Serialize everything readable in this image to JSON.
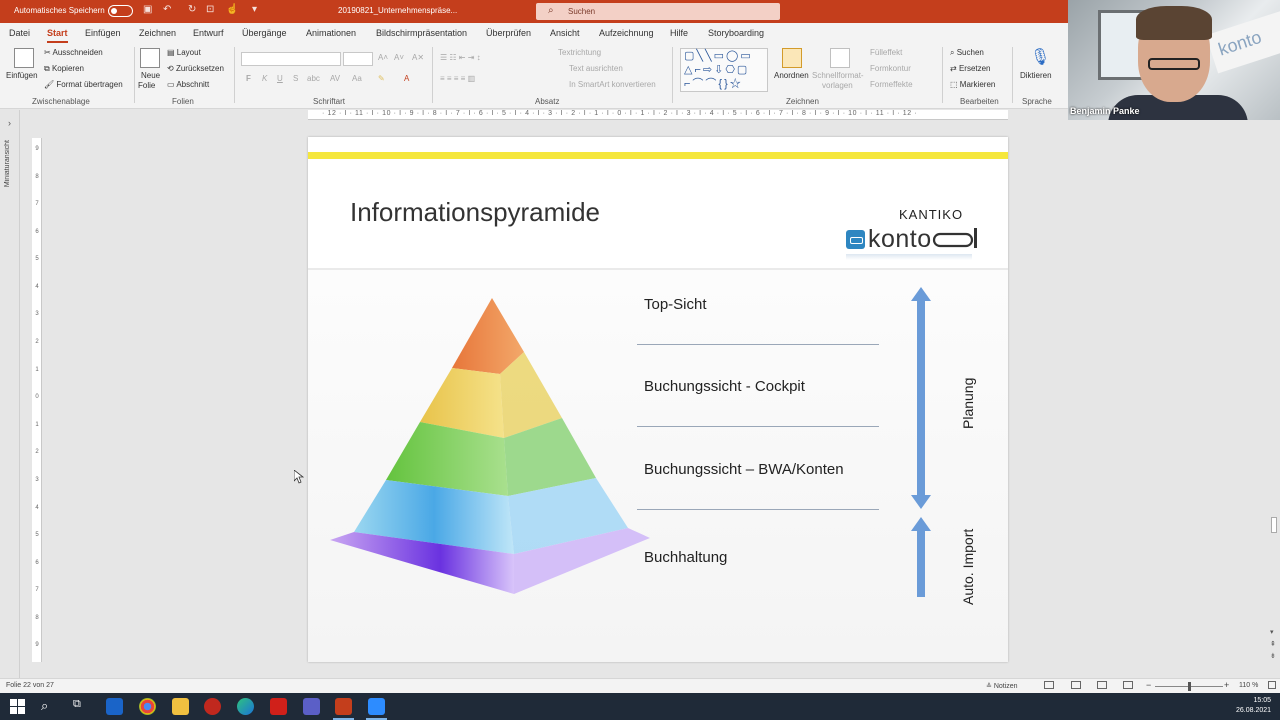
{
  "titlebar": {
    "autosave_label": "Automatisches Speichern",
    "filename": "20190821_Unternehmenspräse...",
    "search_placeholder": "Suchen"
  },
  "tabs": [
    "Datei",
    "Start",
    "Einfügen",
    "Zeichnen",
    "Entwurf",
    "Übergänge",
    "Animationen",
    "Bildschirmpräsentation",
    "Überprüfen",
    "Ansicht",
    "Aufzeichnung",
    "Hilfe",
    "Storyboarding"
  ],
  "active_tab": "Start",
  "ribbon": {
    "clipboard": {
      "paste": "Einfügen",
      "cut": "Ausschneiden",
      "copy": "Kopieren",
      "format_painter": "Format übertragen",
      "label": "Zwischenablage"
    },
    "slides": {
      "new_slide_1": "Neue",
      "new_slide_2": "Folie",
      "layout": "Layout",
      "reset": "Zurücksetzen",
      "section": "Abschnitt",
      "label": "Folien"
    },
    "font": {
      "bold": "F",
      "italic": "K",
      "underline": "U",
      "strike": "S",
      "label": "Schriftart"
    },
    "paragraph": {
      "text_direction": "Textrichtung",
      "align_text": "Text ausrichten",
      "smartart": "In SmartArt konvertieren",
      "label": "Absatz"
    },
    "drawing": {
      "arrange": "Anordnen",
      "quick_styles_1": "Schnellformat-",
      "quick_styles_2": "vorlagen",
      "fill": "Fülleffekt",
      "outline": "Formkontur",
      "effects": "Formeffekte",
      "label": "Zeichnen"
    },
    "editing": {
      "find": "Suchen",
      "replace": "Ersetzen",
      "select": "Markieren",
      "label": "Bearbeiten"
    },
    "voice": {
      "dictate": "Diktieren",
      "label": "Sprache"
    }
  },
  "webcam": {
    "participant_name": "Benjamin Panke",
    "background_sign": "konto"
  },
  "thumbnail_pane_label": "Miniaturansicht",
  "ruler": {
    "horizontal": "· 12 · I · 11 · I · 10 · I · 9 · I · 8 · I · 7 · I · 6 · I · 5 · I · 4 · I · 3 · I · 2 · I · 1 · I · 0 · I · 1 · I · 2 · I · 3 · I · 4 · I · 5 · I · 6 · I · 7 · I · 8 · I · 9 · I · 10 · I · 11 · I · 12 ·",
    "vertical": [
      "9",
      "8",
      "7",
      "6",
      "5",
      "4",
      "3",
      "2",
      "1",
      "0",
      "1",
      "2",
      "3",
      "4",
      "5",
      "6",
      "7",
      "8",
      "9"
    ]
  },
  "slide": {
    "title": "Informationspyramide",
    "logo_top": "KANTIKO",
    "logo_main": "konto",
    "levels": [
      "Top-Sicht",
      "Buchungssicht - Cockpit",
      "Buchungssicht – BWA/Konten",
      "Buchhaltung"
    ],
    "arrow_labels": [
      "Planung",
      "Auto. Import"
    ]
  },
  "statusbar": {
    "slide_info": "Folie 22 von 27",
    "notes": "Notizen",
    "zoom": "110 %"
  },
  "taskbar": {
    "time": "15:05",
    "date": "26.08.2021"
  },
  "colors": {
    "ppt_accent": "#c43e1c",
    "slide_yellow": "#f5e73c",
    "arrow_blue": "#6a9bd8"
  }
}
